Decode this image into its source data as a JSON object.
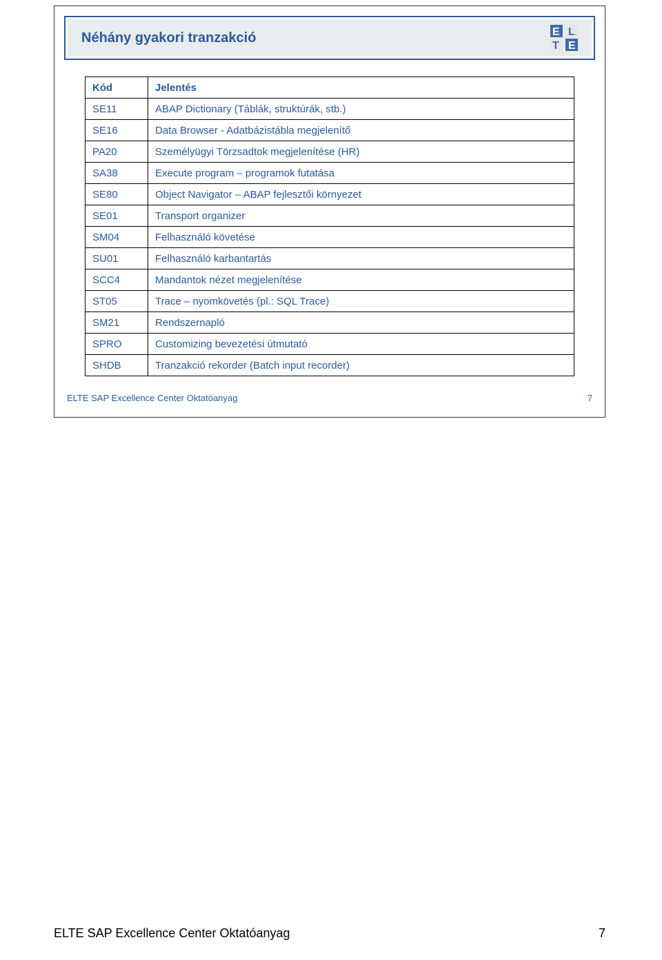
{
  "slide": {
    "title": "Néhány gyakori tranzakció",
    "footer_text": "ELTE SAP Excellence Center Oktatóanyag",
    "footer_page": "7"
  },
  "logo": {
    "letters": "ELTE",
    "color_a": "#3e69a8",
    "color_b": "#d8d8d8"
  },
  "table": {
    "header": {
      "code": "Kód",
      "desc": "Jelentés"
    },
    "rows": [
      {
        "code": "SE11",
        "desc": "ABAP Dictionary (Táblák, struktúrák, stb.)"
      },
      {
        "code": "SE16",
        "desc": "Data Browser - Adatbázistábla megjelenítő"
      },
      {
        "code": "PA20",
        "desc": "Személyügyi Törzsadtok megjelenítése (HR)"
      },
      {
        "code": "SA38",
        "desc": "Execute program – programok futatása"
      },
      {
        "code": "SE80",
        "desc": "Object Navigator – ABAP fejlesztői környezet"
      },
      {
        "code": "SE01",
        "desc": "Transport organizer"
      },
      {
        "code": "SM04",
        "desc": "Felhasználó követése"
      },
      {
        "code": "SU01",
        "desc": "Felhasználó karbantartás"
      },
      {
        "code": "SCC4",
        "desc": "Mandantok nézet megjelenítése"
      },
      {
        "code": "ST05",
        "desc": "Trace – nyomkövetés (pl.: SQL Trace)"
      },
      {
        "code": "SM21",
        "desc": "Rendszernapló"
      },
      {
        "code": "SPRO",
        "desc": "Customizing bevezetési útmutató"
      },
      {
        "code": "SHDB",
        "desc": "Tranzakció rekorder (Batch input recorder)"
      }
    ]
  },
  "page_footer": {
    "text": "ELTE SAP Excellence Center Oktatóanyag",
    "page": "7"
  }
}
